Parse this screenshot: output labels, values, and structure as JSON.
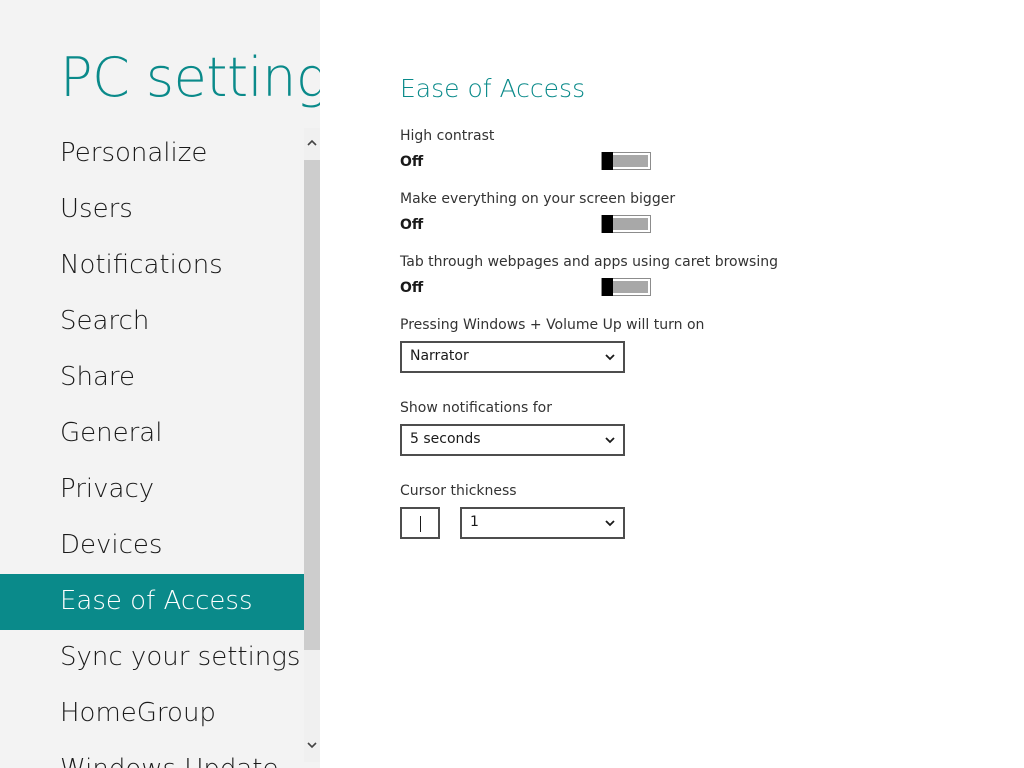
{
  "app": {
    "title": "PC settings"
  },
  "nav": {
    "items": [
      {
        "label": "Personalize",
        "selected": false
      },
      {
        "label": "Users",
        "selected": false
      },
      {
        "label": "Notifications",
        "selected": false
      },
      {
        "label": "Search",
        "selected": false
      },
      {
        "label": "Share",
        "selected": false
      },
      {
        "label": "General",
        "selected": false
      },
      {
        "label": "Privacy",
        "selected": false
      },
      {
        "label": "Devices",
        "selected": false
      },
      {
        "label": "Ease of Access",
        "selected": true
      },
      {
        "label": "Sync your settings",
        "selected": false
      },
      {
        "label": "HomeGroup",
        "selected": false
      },
      {
        "label": "Windows Update",
        "selected": false
      }
    ],
    "scroll_up_icon": "chevron-up-icon",
    "scroll_down_icon": "chevron-down-icon"
  },
  "section": {
    "title": "Ease of Access"
  },
  "settings": {
    "high_contrast": {
      "label": "High contrast",
      "state": "Off"
    },
    "bigger": {
      "label": "Make everything on your screen bigger",
      "state": "Off"
    },
    "caret": {
      "label": "Tab through webpages and apps using caret browsing",
      "state": "Off"
    },
    "volume_up": {
      "label": "Pressing Windows + Volume Up will turn on",
      "value": "Narrator"
    },
    "notifications": {
      "label": "Show notifications for",
      "value": "5 seconds"
    },
    "cursor": {
      "label": "Cursor thickness",
      "value": "1"
    }
  },
  "colors": {
    "accent": "#0a8a8a",
    "left_pane_bg": "#f3f3f3",
    "toggle_off_track": "#a8a8a8"
  }
}
